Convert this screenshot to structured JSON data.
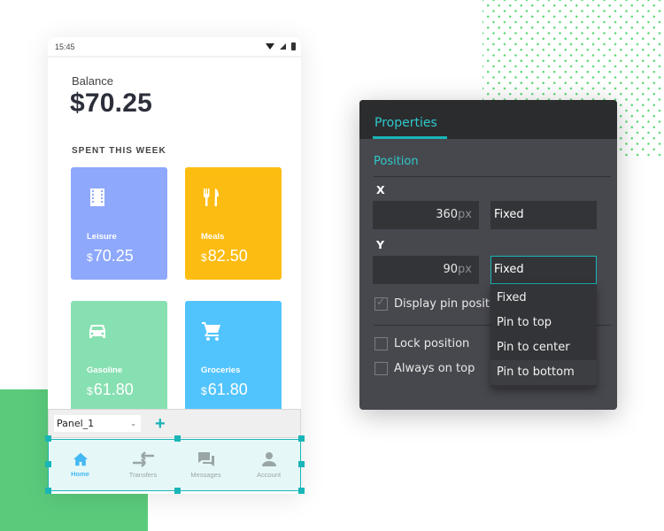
{
  "phone": {
    "status_time": "15:45",
    "balance_label": "Balance",
    "balance_value": "$70.25",
    "spent_label": "SPENT THIS WEEK",
    "cards": [
      {
        "name": "Leisure",
        "currency": "$",
        "amount": "70.25",
        "icon": "film-icon",
        "color": "#8ea8fc"
      },
      {
        "name": "Meals",
        "currency": "$",
        "amount": "82.50",
        "icon": "cutlery-icon",
        "color": "#fdbc12"
      },
      {
        "name": "Gasoline",
        "currency": "$",
        "amount": "61.80",
        "icon": "car-icon",
        "color": "#87e0b1"
      },
      {
        "name": "Groceries",
        "currency": "$",
        "amount": "61.80",
        "icon": "cart-icon",
        "color": "#52c4fd"
      }
    ]
  },
  "panel_bar": {
    "selected_panel": "Panel_1",
    "add_label": "+"
  },
  "nav": {
    "items": [
      {
        "label": "Home",
        "icon": "home-icon",
        "active": true
      },
      {
        "label": "Transfers",
        "icon": "transfers-icon",
        "active": false
      },
      {
        "label": "Messages",
        "icon": "messages-icon",
        "active": false
      },
      {
        "label": "Account",
        "icon": "account-icon",
        "active": false
      }
    ]
  },
  "properties": {
    "tab_label": "Properties",
    "section_title": "Position",
    "x": {
      "label": "X",
      "value": "360",
      "unit": "px",
      "mode": "Fixed"
    },
    "y": {
      "label": "Y",
      "value": "90",
      "unit": "px",
      "mode": "Fixed"
    },
    "display_pin_label": "Display pin posit",
    "display_pin_checked": true,
    "lock_position_label": "Lock position",
    "lock_position_checked": false,
    "always_on_top_label": "Always on top",
    "always_on_top_checked": false,
    "dropdown_options": [
      "Fixed",
      "Pin to top",
      "Pin to center",
      "Pin to bottom"
    ],
    "dropdown_hovered": "Pin to bottom"
  },
  "colors": {
    "accent": "#19b5b7",
    "nav_active": "#44b8f2",
    "panel_bg": "#47484e"
  }
}
